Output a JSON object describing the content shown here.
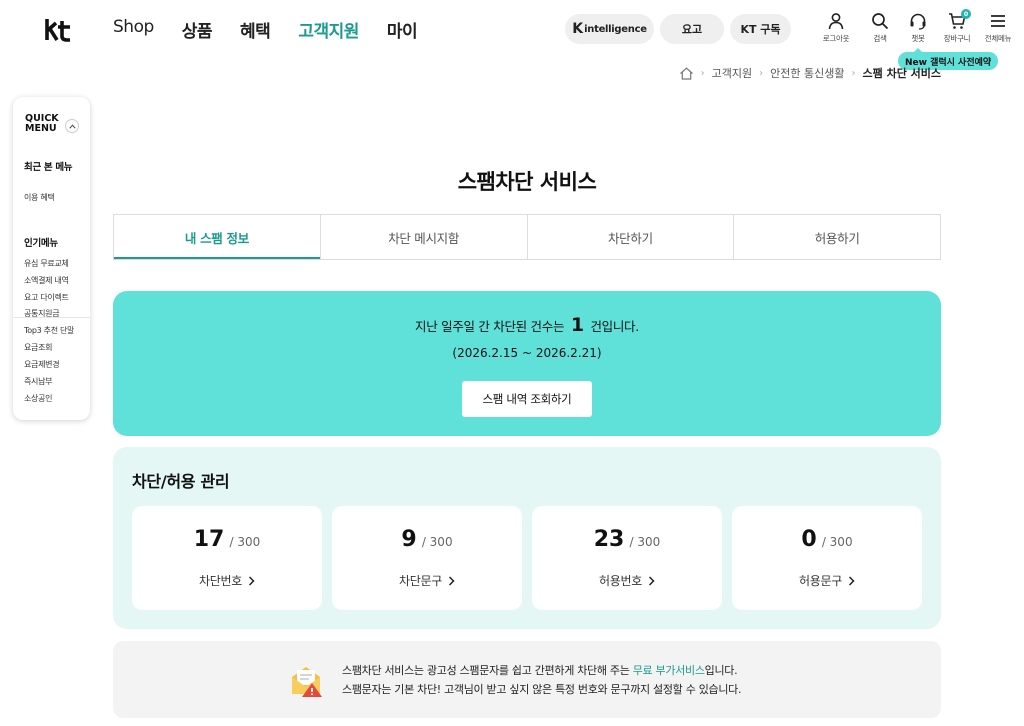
{
  "brand": {
    "logo": "kt",
    "accent": "#1b9a8f",
    "mint": "#5fe0d9"
  },
  "nav": {
    "items": [
      "Shop",
      "상품",
      "혜택",
      "고객지원",
      "마이"
    ],
    "active": "고객지원"
  },
  "header_pills": {
    "k_mark": "K",
    "k_text": "intelligence",
    "rate": "요고",
    "subscribe": "KT 구독"
  },
  "utilities": {
    "login": "로그아웃",
    "search": "검색",
    "chatbot": "챗봇",
    "cart": "장바구니",
    "cart_count": "0",
    "menu": "전체메뉴"
  },
  "promo": "New 갤럭시 사전예약",
  "breadcrumb": {
    "items": [
      "고객지원",
      "안전한 통신생활"
    ],
    "current": "스팸 차단 서비스"
  },
  "quick_menu": {
    "title_1": "QUICK",
    "title_2": "MENU",
    "recent_heading": "최근 본 메뉴",
    "recent_items": [
      "이용 혜택"
    ],
    "popular_heading": "인기메뉴",
    "popular_items": [
      "유심 무료교체",
      "소액결제 내역",
      "요고 다이렉트",
      "공통지원금",
      "Top3 추천 단말",
      "요금조회",
      "요금제변경",
      "즉시납부",
      "소상공인"
    ]
  },
  "page": {
    "title": "스팸차단 서비스"
  },
  "tabs": [
    "내 스팸 정보",
    "차단 메시지함",
    "차단하기",
    "허용하기"
  ],
  "active_tab": "내 스팸 정보",
  "summary": {
    "line_prefix": "지난 일주일 간 차단된 건수는",
    "count": "1",
    "line_suffix": "건입니다.",
    "period": "(2026.2.15 ~ 2026.2.21)",
    "button": "스팸 내역 조회하기"
  },
  "management": {
    "title": "차단/허용 관리",
    "cards": [
      {
        "count": "17",
        "max": "/ 300",
        "label": "차단번호"
      },
      {
        "count": "9",
        "max": "/ 300",
        "label": "차단문구"
      },
      {
        "count": "23",
        "max": "/ 300",
        "label": "허용번호"
      },
      {
        "count": "0",
        "max": "/ 300",
        "label": "허용문구"
      }
    ]
  },
  "info": {
    "line1_prefix": "스팸차단 서비스는 광고성 스팸문자를 쉽고 간편하게 차단해 주는",
    "line1_accent": "무료 부가서비스",
    "line1_suffix": "입니다.",
    "line2": "스팸문자는 기본 차단! 고객님이 받고 싶지 않은 특정 번호와 문구까지 설정할 수 있습니다."
  }
}
